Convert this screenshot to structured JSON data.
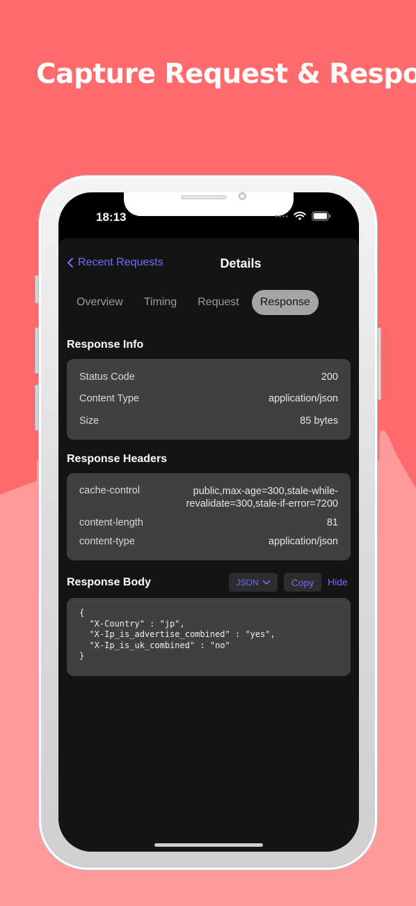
{
  "headline": "Capture Request & Response",
  "colors": {
    "bg_top": "#ff6b6c",
    "bg_bottom": "#ff9a9c",
    "accent": "#6e6ef7",
    "card": "#404040"
  },
  "status_bar": {
    "time": "18:13",
    "icons": [
      "signal-dots-icon",
      "wifi-icon",
      "battery-icon"
    ]
  },
  "nav": {
    "back_label": "Recent Requests",
    "title": "Details"
  },
  "tabs": [
    {
      "label": "Overview",
      "active": false
    },
    {
      "label": "Timing",
      "active": false
    },
    {
      "label": "Request",
      "active": false
    },
    {
      "label": "Response",
      "active": true
    }
  ],
  "response_info": {
    "title": "Response Info",
    "rows": [
      {
        "key": "Status Code",
        "value": "200"
      },
      {
        "key": "Content Type",
        "value": "application/json"
      },
      {
        "key": "Size",
        "value": "85 bytes"
      }
    ]
  },
  "response_headers": {
    "title": "Response Headers",
    "rows": [
      {
        "key": "cache-control",
        "value_line1": "public,max-age=300,stale-while-",
        "value_line2": "revalidate=300,stale-if-error=7200"
      },
      {
        "key": "content-length",
        "value": "81"
      },
      {
        "key": "content-type",
        "value": "application/json"
      }
    ]
  },
  "response_body": {
    "title": "Response Body",
    "format_label": "JSON",
    "copy_label": "Copy",
    "hide_label": "Hide",
    "code": "{\n  \"X-Country\" : \"jp\",\n  \"X-Ip_is_advertise_combined\" : \"yes\",\n  \"X-Ip_is_uk_combined\" : \"no\"\n}"
  }
}
